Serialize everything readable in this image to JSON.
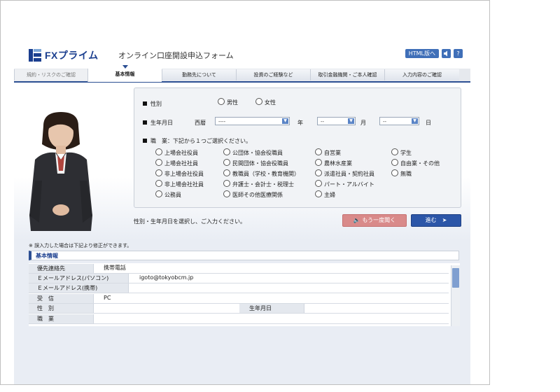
{
  "header": {
    "logo_text": "FXプライム",
    "form_title": "オンライン口座開設申込フォーム",
    "html_button": "HTML版へ",
    "sound_icon": "speaker-icon",
    "help_label": "?"
  },
  "tabs": [
    {
      "label": "規約・リスクのご確認"
    },
    {
      "label": "基本情報"
    },
    {
      "label": "勤務先について"
    },
    {
      "label": "投資のご経験など"
    },
    {
      "label": "取引金融機関・ご本人確認"
    },
    {
      "label": "入力内容のご確認"
    }
  ],
  "form": {
    "gender_label": "性別",
    "male": "男性",
    "female": "女性",
    "birth_label": "生年月日",
    "era_label": "西暦",
    "year_value": "----",
    "year_unit": "年",
    "month_value": "--",
    "month_unit": "月",
    "day_value": "--",
    "day_unit": "日",
    "occupation_label": "職　業：下記から１つご選択ください。",
    "occupations": [
      "上場会社役員",
      "上場会社社員",
      "非上場会社役員",
      "非上場会社社員",
      "公務員",
      "公団体・協会役職員",
      "民間団体・協会役職員",
      "教職員（学校・教育機関）",
      "弁護士・会計士・税理士",
      "医師その他医療関係",
      "自営業",
      "農林水産業",
      "派遣社員・契約社員",
      "パート・アルバイト",
      "主婦",
      "学生",
      "自由業・その他",
      "無職"
    ]
  },
  "instruction": "性別・生年月日を選択し、ご入力ください。",
  "buttons": {
    "again": "もう一度聞く",
    "next": "進む"
  },
  "summary": {
    "note": "※ 誤入力した場合は下記より修正ができます。",
    "section_title": "基本情報",
    "rows": [
      {
        "label": "優先連絡先",
        "value": "携帯電話"
      },
      {
        "label": "Ｅメールアドレス(パソコン)",
        "value": "igoto@tokyobcm.jp"
      },
      {
        "label": "Ｅメールアドレス(携帯)",
        "value": ""
      },
      {
        "label": "受　信",
        "value": "PC"
      },
      {
        "label": "性　別",
        "value": "",
        "extra_label": "生年月日"
      },
      {
        "label": "職　業",
        "value": ""
      }
    ]
  },
  "colors": {
    "brand": "#1b3f8f",
    "accent": "#2c56a8",
    "again_button": "#d98a8a"
  }
}
